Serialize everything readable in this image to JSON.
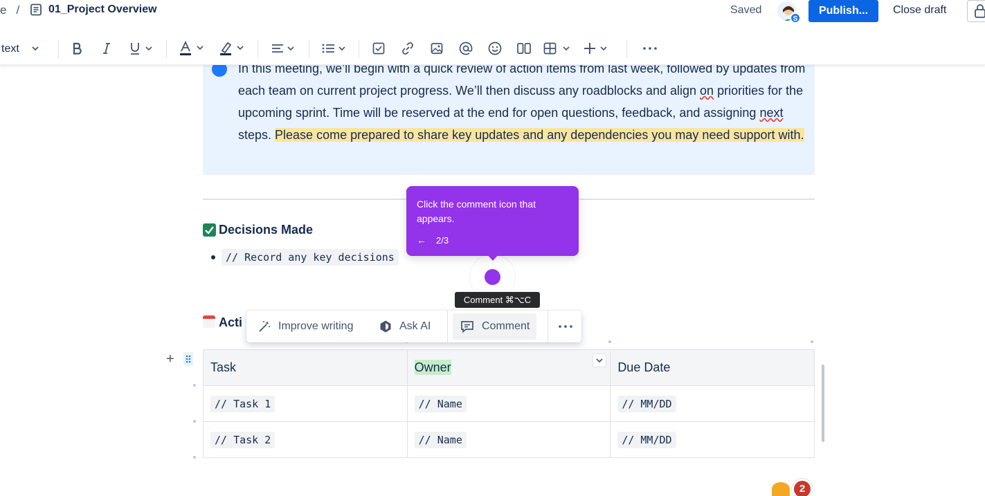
{
  "breadcrumb": {
    "prefix": "e",
    "separator": "/",
    "page_title": "01_Project Overview"
  },
  "header": {
    "status": "Saved",
    "avatar_badge": "S",
    "publish_label": "Publish...",
    "close_draft_label": "Close draft"
  },
  "toolbar": {
    "text_style": "text",
    "tools": [
      "bold-icon",
      "italic-icon",
      "underline-icon",
      "text-color-icon",
      "highlight-icon",
      "align-icon",
      "list-icon",
      "task-icon",
      "link-icon",
      "image-icon",
      "mention-icon",
      "emoji-icon",
      "layout-icon",
      "table-icon",
      "insert-icon",
      "more-icon"
    ]
  },
  "info_panel": {
    "text_part1": "In this meeting, we’ll begin with a quick review of action items from last week, followed by updates from each team on current project progress. We’ll then discuss any roadblocks and align ",
    "word_on": "on",
    "text_part2": " priorities for the upcoming sprint. Time will be reserved at the end for open questions, feedback, and assigning ",
    "word_next": "next",
    "text_part3": " steps. ",
    "highlight": "Please come prepared to share key updates and any dependencies you may need support with."
  },
  "decisions": {
    "title": "Decisions Made",
    "item": "// Record any key decisions"
  },
  "action_items": {
    "title": "Acti"
  },
  "floating_toolbar": {
    "improve_label": "Improve writing",
    "ask_ai_label": "Ask AI",
    "comment_label": "Comment"
  },
  "tour": {
    "text": "Click the comment icon that appears.",
    "back": "←",
    "step": "2/3",
    "tooltip": "Comment ⌘⌥C"
  },
  "table": {
    "headers": [
      "Task",
      "Owner",
      "Due Date"
    ],
    "rows": [
      [
        "// Task 1",
        "// Name",
        "// MM/DD"
      ],
      [
        "// Task 2",
        "// Name",
        "// MM/DD"
      ]
    ]
  },
  "notifications": {
    "count": "2"
  },
  "colors": {
    "primary": "#0c66e4",
    "tour": "#9333ea",
    "info_bg": "#e9f2ff",
    "highlight": "#f8e6a0",
    "owner_highlight": "#c6edcb",
    "badge": "#c9372c"
  }
}
